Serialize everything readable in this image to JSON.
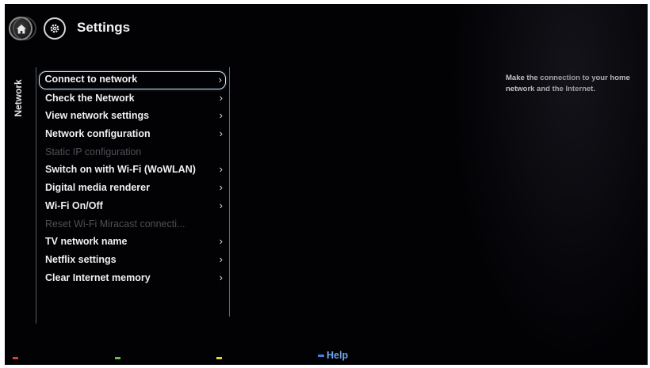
{
  "header": {
    "title": "Settings",
    "home_icon": "home-icon",
    "settings_icon": "gear-icon"
  },
  "category": {
    "label": "Network"
  },
  "menu": {
    "items": [
      {
        "label": "Connect to network",
        "state": "selected"
      },
      {
        "label": "Check the Network",
        "state": "enabled"
      },
      {
        "label": "View network settings",
        "state": "enabled"
      },
      {
        "label": "Network configuration",
        "state": "enabled"
      },
      {
        "label": "Static IP configuration",
        "state": "disabled"
      },
      {
        "label": "Switch on with Wi-Fi (WoWLAN)",
        "state": "enabled"
      },
      {
        "label": "Digital media renderer",
        "state": "enabled"
      },
      {
        "label": "Wi-Fi On/Off",
        "state": "enabled"
      },
      {
        "label": "Reset Wi-Fi Miracast connecti...",
        "state": "disabled"
      },
      {
        "label": "TV network name",
        "state": "enabled"
      },
      {
        "label": "Netflix settings",
        "state": "enabled"
      },
      {
        "label": "Clear Internet memory",
        "state": "enabled"
      }
    ],
    "chevron": "›"
  },
  "description": {
    "text": "Make the connection to your home network and the Internet."
  },
  "footer": {
    "color_keys": [
      "#e23a2e",
      "#5fc24a",
      "#e8d23a",
      "#3f7fe0"
    ],
    "help_label": "Help"
  }
}
